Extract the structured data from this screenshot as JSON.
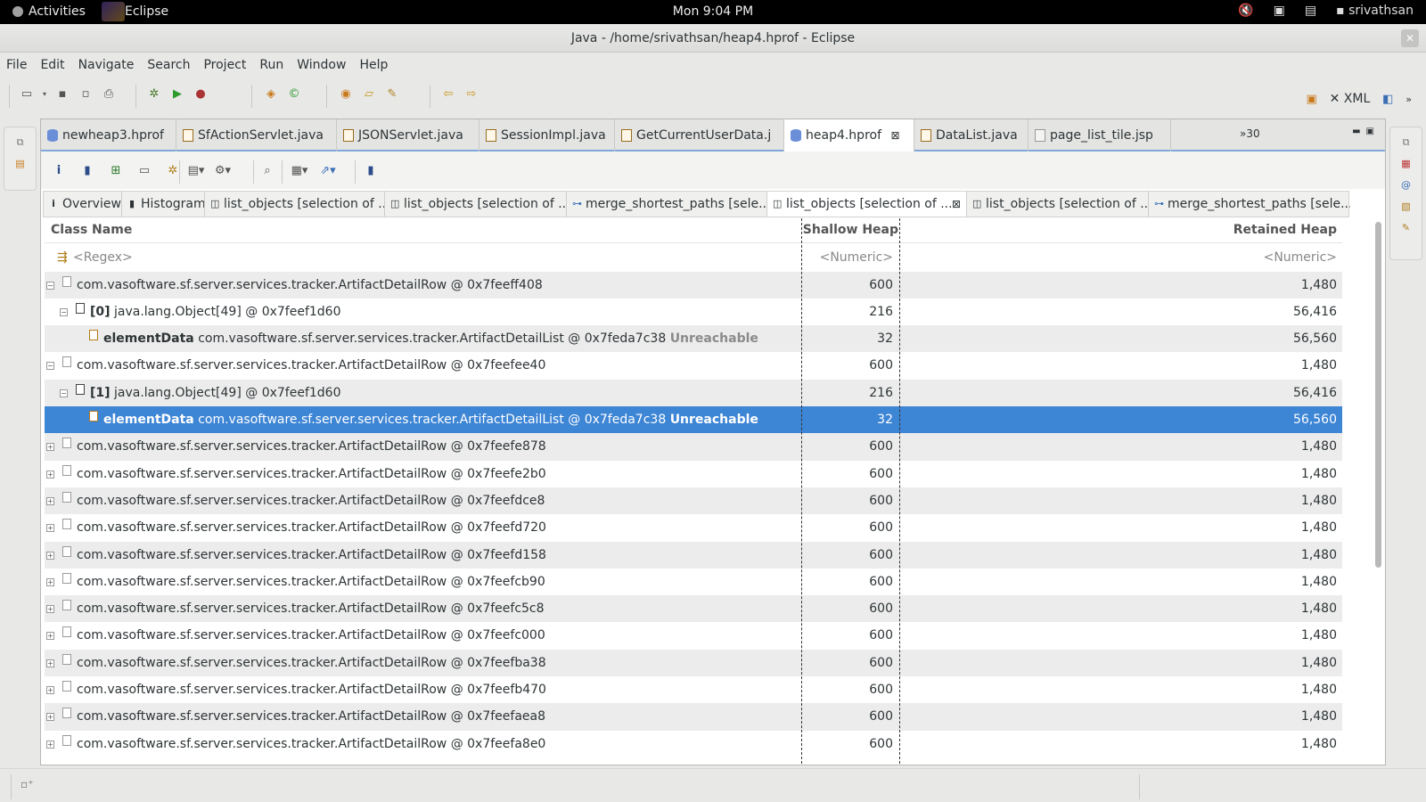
{
  "topbar": {
    "activities": "Activities",
    "app_name": "Eclipse",
    "clock": "Mon  9:04 PM",
    "user": "srivathsan"
  },
  "window": {
    "title": "Java - /home/srivathsan/heap4.hprof - Eclipse",
    "close": "✕"
  },
  "menu": [
    "File",
    "Edit",
    "Navigate",
    "Search",
    "Project",
    "Run",
    "Window",
    "Help"
  ],
  "perspectives": {
    "xml_label": "XML"
  },
  "editor_tabs": [
    {
      "label": "newheap3.hprof",
      "icon": "heap-file-icon"
    },
    {
      "label": "SfActionServlet.java",
      "icon": "java-file-icon"
    },
    {
      "label": "JSONServlet.java",
      "icon": "java-file-icon"
    },
    {
      "label": "SessionImpl.java",
      "icon": "java-file-icon"
    },
    {
      "label": "GetCurrentUserData.j",
      "icon": "java-file-icon"
    },
    {
      "label": "heap4.hprof",
      "icon": "heap-file-icon",
      "active": true
    },
    {
      "label": "DataList.java",
      "icon": "java-file-icon"
    },
    {
      "label": "page_list_tile.jsp",
      "icon": "jsp-file-icon"
    }
  ],
  "editor_more": "»30",
  "sub_tabs": [
    {
      "label": "Overview",
      "icon": "info-icon"
    },
    {
      "label": "Histogram",
      "icon": "histogram-icon"
    },
    {
      "label": "list_objects [selection of ...",
      "icon": "query-icon"
    },
    {
      "label": "list_objects [selection of ...",
      "icon": "query-icon"
    },
    {
      "label": "merge_shortest_paths [sele...",
      "icon": "paths-icon"
    },
    {
      "label": "list_objects [selection of ...",
      "icon": "query-icon",
      "active": true
    },
    {
      "label": "list_objects [selection of ...",
      "icon": "query-icon"
    },
    {
      "label": "merge_shortest_paths [sele...",
      "icon": "paths-icon"
    }
  ],
  "table": {
    "headers": {
      "class_name": "Class Name",
      "shallow": "Shallow Heap",
      "retained": "Retained Heap"
    },
    "filter": {
      "class_name": "<Regex>",
      "shallow": "<Numeric>",
      "retained": "<Numeric>"
    },
    "rows": [
      {
        "level": 0,
        "expander": "−",
        "prefix": "",
        "name": "com.vasoftware.sf.server.services.tracker.ArtifactDetailRow @ 0x7feeff408",
        "suffix": "",
        "shallow": "600",
        "retained": "1,480"
      },
      {
        "level": 1,
        "expander": "−",
        "prefix": "[0]",
        "name": "java.lang.Object[49] @ 0x7feef1d60",
        "suffix": "",
        "shallow": "216",
        "retained": "56,416"
      },
      {
        "level": 2,
        "expander": "",
        "prefix": "elementData",
        "name": "com.vasoftware.sf.server.services.tracker.ArtifactDetailList @ 0x7feda7c38",
        "suffix": "Unreachable",
        "shallow": "32",
        "retained": "56,560"
      },
      {
        "level": 0,
        "expander": "−",
        "prefix": "",
        "name": "com.vasoftware.sf.server.services.tracker.ArtifactDetailRow @ 0x7feefee40",
        "suffix": "",
        "shallow": "600",
        "retained": "1,480"
      },
      {
        "level": 1,
        "expander": "−",
        "prefix": "[1]",
        "name": "java.lang.Object[49] @ 0x7feef1d60",
        "suffix": "",
        "shallow": "216",
        "retained": "56,416"
      },
      {
        "level": 2,
        "expander": "",
        "prefix": "elementData",
        "name": "com.vasoftware.sf.server.services.tracker.ArtifactDetailList @ 0x7feda7c38",
        "suffix": "Unreachable",
        "shallow": "32",
        "retained": "56,560",
        "selected": true
      },
      {
        "level": 0,
        "expander": "+",
        "prefix": "",
        "name": "com.vasoftware.sf.server.services.tracker.ArtifactDetailRow @ 0x7feefe878",
        "suffix": "",
        "shallow": "600",
        "retained": "1,480"
      },
      {
        "level": 0,
        "expander": "+",
        "prefix": "",
        "name": "com.vasoftware.sf.server.services.tracker.ArtifactDetailRow @ 0x7feefe2b0",
        "suffix": "",
        "shallow": "600",
        "retained": "1,480"
      },
      {
        "level": 0,
        "expander": "+",
        "prefix": "",
        "name": "com.vasoftware.sf.server.services.tracker.ArtifactDetailRow @ 0x7feefdce8",
        "suffix": "",
        "shallow": "600",
        "retained": "1,480"
      },
      {
        "level": 0,
        "expander": "+",
        "prefix": "",
        "name": "com.vasoftware.sf.server.services.tracker.ArtifactDetailRow @ 0x7feefd720",
        "suffix": "",
        "shallow": "600",
        "retained": "1,480"
      },
      {
        "level": 0,
        "expander": "+",
        "prefix": "",
        "name": "com.vasoftware.sf.server.services.tracker.ArtifactDetailRow @ 0x7feefd158",
        "suffix": "",
        "shallow": "600",
        "retained": "1,480"
      },
      {
        "level": 0,
        "expander": "+",
        "prefix": "",
        "name": "com.vasoftware.sf.server.services.tracker.ArtifactDetailRow @ 0x7feefcb90",
        "suffix": "",
        "shallow": "600",
        "retained": "1,480"
      },
      {
        "level": 0,
        "expander": "+",
        "prefix": "",
        "name": "com.vasoftware.sf.server.services.tracker.ArtifactDetailRow @ 0x7feefc5c8",
        "suffix": "",
        "shallow": "600",
        "retained": "1,480"
      },
      {
        "level": 0,
        "expander": "+",
        "prefix": "",
        "name": "com.vasoftware.sf.server.services.tracker.ArtifactDetailRow @ 0x7feefc000",
        "suffix": "",
        "shallow": "600",
        "retained": "1,480"
      },
      {
        "level": 0,
        "expander": "+",
        "prefix": "",
        "name": "com.vasoftware.sf.server.services.tracker.ArtifactDetailRow @ 0x7feefba38",
        "suffix": "",
        "shallow": "600",
        "retained": "1,480"
      },
      {
        "level": 0,
        "expander": "+",
        "prefix": "",
        "name": "com.vasoftware.sf.server.services.tracker.ArtifactDetailRow @ 0x7feefb470",
        "suffix": "",
        "shallow": "600",
        "retained": "1,480"
      },
      {
        "level": 0,
        "expander": "+",
        "prefix": "",
        "name": "com.vasoftware.sf.server.services.tracker.ArtifactDetailRow @ 0x7feefaea8",
        "suffix": "",
        "shallow": "600",
        "retained": "1,480"
      },
      {
        "level": 0,
        "expander": "+",
        "prefix": "",
        "name": "com.vasoftware.sf.server.services.tracker.ArtifactDetailRow @ 0x7feefa8e0",
        "suffix": "",
        "shallow": "600",
        "retained": "1,480"
      }
    ]
  },
  "colors": {
    "selection": "#3d85d5",
    "unreachable": "#8a8a8a",
    "tab_accent": "#7fa7d9"
  }
}
